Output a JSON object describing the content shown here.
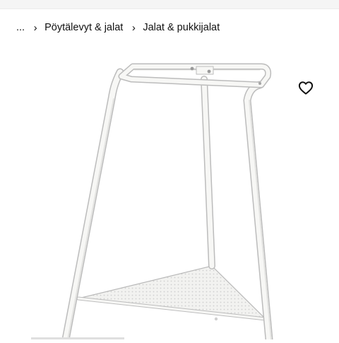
{
  "breadcrumb": {
    "ellipsis": "...",
    "separator": "›",
    "items": [
      {
        "label": "Pöytälevyt & jalat"
      },
      {
        "label": "Jalat & pukkijalat"
      }
    ]
  },
  "product": {
    "favorite_icon": "heart-icon",
    "image": "white metal trestle leg with triangular mesh shelf"
  },
  "colors": {
    "text": "#111111",
    "frame": "#f7f7f5",
    "frame_outline": "#bdbdbd"
  }
}
